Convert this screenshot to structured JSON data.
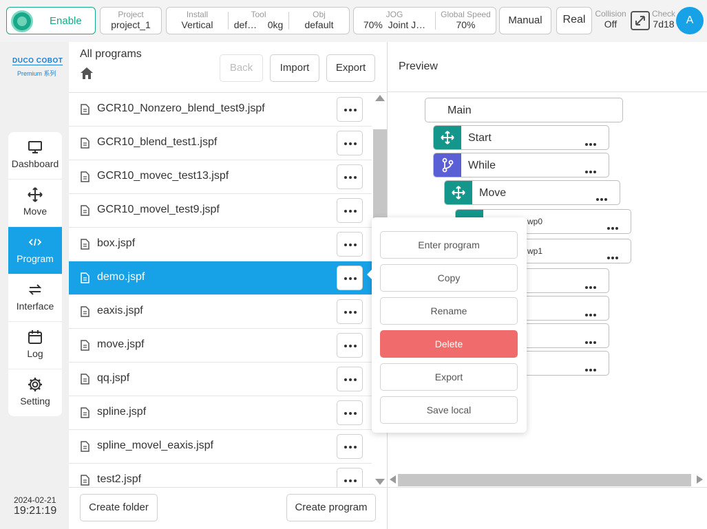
{
  "topbar": {
    "enable_label": "Enable",
    "project": {
      "label": "Project",
      "value": "project_1"
    },
    "install": {
      "label": "Install",
      "value": "Vertical"
    },
    "tool": {
      "label": "Tool",
      "value": "def…",
      "value2": "0kg"
    },
    "obj": {
      "label": "Obj",
      "value": "default"
    },
    "jog": {
      "label": "JOG",
      "value": "70%",
      "value2": "Joint J…"
    },
    "global_speed": {
      "label": "Global Speed",
      "value": "70%"
    },
    "mode_label": "Manual",
    "real_label": "Real",
    "collision": {
      "label": "Collision",
      "value": "Off"
    },
    "check": {
      "label": "Check",
      "value": "7d18"
    },
    "avatar": "A"
  },
  "brand": {
    "line1": "DUCO COBOT",
    "line2": "Premium 系列"
  },
  "nav": {
    "items": [
      {
        "label": "Dashboard",
        "icon": "monitor-icon"
      },
      {
        "label": "Move",
        "icon": "move-arrows-icon"
      },
      {
        "label": "Program",
        "icon": "code-icon"
      },
      {
        "label": "Interface",
        "icon": "swap-icon"
      },
      {
        "label": "Log",
        "icon": "calendar-icon"
      },
      {
        "label": "Setting",
        "icon": "gear-icon"
      }
    ],
    "active": "Program"
  },
  "clock": {
    "date": "2024-02-21",
    "time": "19:21:19"
  },
  "programs": {
    "breadcrumb": "All programs",
    "back_label": "Back",
    "import_label": "Import",
    "export_label": "Export",
    "files": [
      "GCR10_Nonzero_blend_test9.jspf",
      "GCR10_blend_test1.jspf",
      "GCR10_movec_test13.jspf",
      "GCR10_movel_test9.jspf",
      "box.jspf",
      "demo.jspf",
      "eaxis.jspf",
      "move.jspf",
      "qq.jspf",
      "spline.jspf",
      "spline_movel_eaxis.jspf",
      "test2.jspf"
    ],
    "selected": "demo.jspf",
    "create_folder_label": "Create folder",
    "create_program_label": "Create program"
  },
  "preview": {
    "title": "Preview",
    "nodes": [
      "Main",
      "Start",
      "While",
      "Move",
      "wp0",
      "wp1"
    ]
  },
  "context_menu": {
    "items": [
      "Enter program",
      "Copy",
      "Rename",
      "Delete",
      "Export",
      "Save local"
    ]
  },
  "colors": {
    "accent": "#17a2e8",
    "green": "#1aa88a",
    "teal": "#14968a",
    "purple": "#5b5fd6",
    "delete": "#f06b6b"
  }
}
